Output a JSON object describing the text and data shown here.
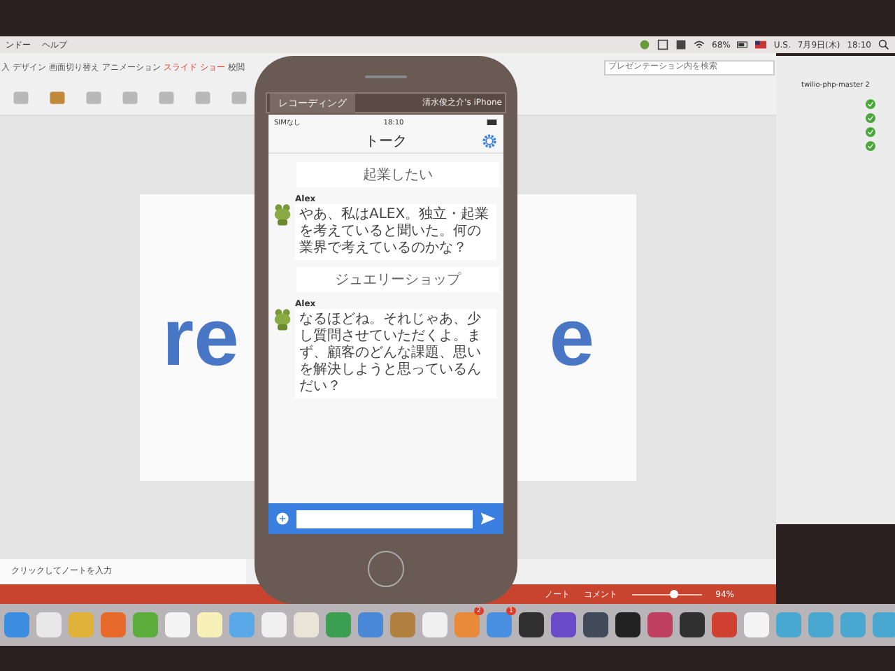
{
  "menubar": {
    "menus": [
      "ンドー",
      "ヘルプ"
    ],
    "battery": "68%",
    "input_source": "U.S.",
    "date": "7月9日(木)",
    "time": "18:10"
  },
  "presentation": {
    "tabs": [
      {
        "label": "入",
        "selected": false
      },
      {
        "label": "デザイン",
        "selected": false
      },
      {
        "label": "画面切り替え",
        "selected": false
      },
      {
        "label": "アニメーション",
        "selected": false
      },
      {
        "label": "スライド ショー",
        "selected": true
      },
      {
        "label": "校閲",
        "selected": false
      }
    ],
    "search": {
      "placeholder": "プレゼンテーション内を検索"
    },
    "slide": {
      "text_left": "re",
      "text_right": "e"
    },
    "notes": {
      "placeholder": "クリックしてノートを入力"
    },
    "status_bar": {
      "notes": "ノート",
      "comments": "コメント",
      "zoom": "94%",
      "level": 0.6
    }
  },
  "side_window": {
    "title": "twilio-php-master 2"
  },
  "phone": {
    "recording": "レコーディング",
    "device": "清水俊之介's iPhone",
    "carrier": "SIMなし",
    "time": "18:10",
    "title": "トーク",
    "messages": [
      {
        "kind": "topic",
        "text": "起業したい"
      },
      {
        "kind": "message",
        "sender": "Alex",
        "text": "やあ、私はALEX。独立・起業を考えていると聞いた。何の業界で考えているのかな？"
      },
      {
        "kind": "topic",
        "text": "ジュエリーショップ"
      },
      {
        "kind": "message",
        "sender": "Alex",
        "text": "なるほどね。それじゃあ、少し質問させていただくよ。まず、顧客のどんな課題、思いを解決しようと思っているんだい？"
      }
    ]
  },
  "dock": {
    "badges": [
      "2",
      "1"
    ]
  }
}
